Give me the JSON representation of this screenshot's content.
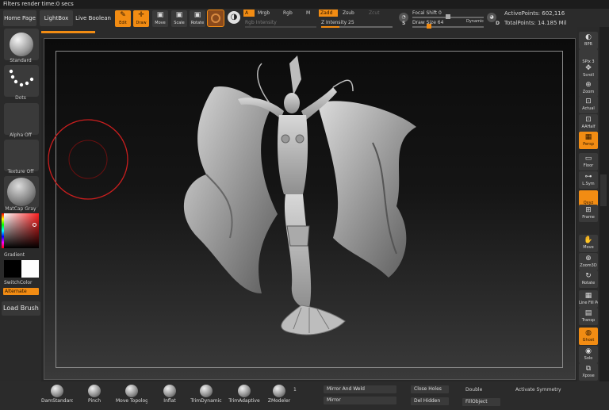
{
  "title": "Filters render time:0 secs",
  "top": {
    "tabs": [
      "Home Page",
      "LightBox",
      "Live Boolean"
    ],
    "tools": [
      {
        "label": "Edit",
        "icon": "edit-icon",
        "glyph": "✎",
        "active": true
      },
      {
        "label": "Draw",
        "icon": "draw-icon",
        "glyph": "✛",
        "active": true
      },
      {
        "label": "Move",
        "icon": "move-icon",
        "glyph": "▣",
        "active": false
      },
      {
        "label": "Scale",
        "icon": "scale-icon",
        "glyph": "▣",
        "active": false
      },
      {
        "label": "Rotate",
        "icon": "rotate-icon",
        "glyph": "▣",
        "active": false
      }
    ],
    "a_label": "A",
    "mrgb": "Mrgb",
    "rgb": "Rgb",
    "m": "M",
    "rgb_intensity": "Rgb Intensity",
    "zadd": "Zadd",
    "zsub": "Zsub",
    "zcut": "Zcut",
    "z_intensity": "Z Intensity 25",
    "z_intensity_value": 25,
    "focal_shift": "Focal Shift 0",
    "draw_size": "Draw Size 64",
    "dynamic": "Dynamic",
    "s_label": "S",
    "d_label": "D",
    "active_points": "ActivePoints: 602,116",
    "total_points": "TotalPoints: 14.185 Mil"
  },
  "left": {
    "brush": "Standard",
    "stroke": "Dots",
    "alpha": "Alpha Off",
    "texture": "Texture Off",
    "material": "MatCap Gray",
    "gradient": "Gradient",
    "switchcolor": "SwitchColor",
    "alternate": "Alternate",
    "load_brush": "Load Brush"
  },
  "right": {
    "items": [
      {
        "label": "BPR",
        "icon": "bpr-icon",
        "glyph": "◐",
        "active": false
      },
      {
        "label": "SPix 3",
        "icon": "spix-icon",
        "glyph": "",
        "active": false
      },
      {
        "label": "Scroll",
        "icon": "scroll-icon",
        "glyph": "✥",
        "active": false
      },
      {
        "label": "Zoom",
        "icon": "zoom-icon",
        "glyph": "⊕",
        "active": false
      },
      {
        "label": "Actual",
        "icon": "actual-icon",
        "glyph": "⊡",
        "active": false
      },
      {
        "label": "AAHalf",
        "icon": "aahalf-icon",
        "glyph": "⊡",
        "active": false
      },
      {
        "label": "Persp",
        "icon": "persp-icon",
        "glyph": "▦",
        "active": true
      },
      {
        "label": "Floor",
        "icon": "floor-icon",
        "glyph": "▭",
        "active": false
      },
      {
        "label": "L.Sym",
        "icon": "lsym-icon",
        "glyph": "⊶",
        "active": false
      },
      {
        "label": "Qxyz",
        "icon": "xyz-icon",
        "glyph": "",
        "active": true
      },
      {
        "label": "Frame",
        "icon": "frame-icon",
        "glyph": "⊞",
        "active": false
      },
      {
        "label": "Move",
        "icon": "move-hand-icon",
        "glyph": "✋",
        "active": false
      },
      {
        "label": "Zoom3D",
        "icon": "zoom3d-icon",
        "glyph": "⊕",
        "active": false
      },
      {
        "label": "Rotate",
        "icon": "rotate3d-icon",
        "glyph": "↻",
        "active": false
      },
      {
        "label": "Line Fill PolyF",
        "icon": "polyf-icon",
        "glyph": "▦",
        "active": false
      },
      {
        "label": "Transp",
        "icon": "transp-icon",
        "glyph": "▤",
        "active": false
      },
      {
        "label": "Ghost",
        "icon": "ghost-icon",
        "glyph": "◍",
        "active": true
      },
      {
        "label": "Solo",
        "icon": "solo-icon",
        "glyph": "◉",
        "active": false
      },
      {
        "label": "Xpose",
        "icon": "xpose-icon",
        "glyph": "⧉",
        "active": false
      }
    ],
    "dynamic": "Dynamic"
  },
  "bottom": {
    "brushes": [
      "DamStandard",
      "Pinch",
      "Move Topologic",
      "Inflat",
      "TrimDynamic",
      "TrimAdaptive",
      "ZModeler"
    ],
    "count": "1",
    "mirror_and_weld": "Mirror And Weld",
    "mirror": "Mirror",
    "close_holes": "Close Holes",
    "del_hidden": "Del Hidden",
    "double": "Double",
    "fill_object": "FillObject",
    "activate_symmetry": "Activate Symmetry"
  },
  "colors": {
    "accent": "#f28c13",
    "cursor": "#c81e1e"
  }
}
